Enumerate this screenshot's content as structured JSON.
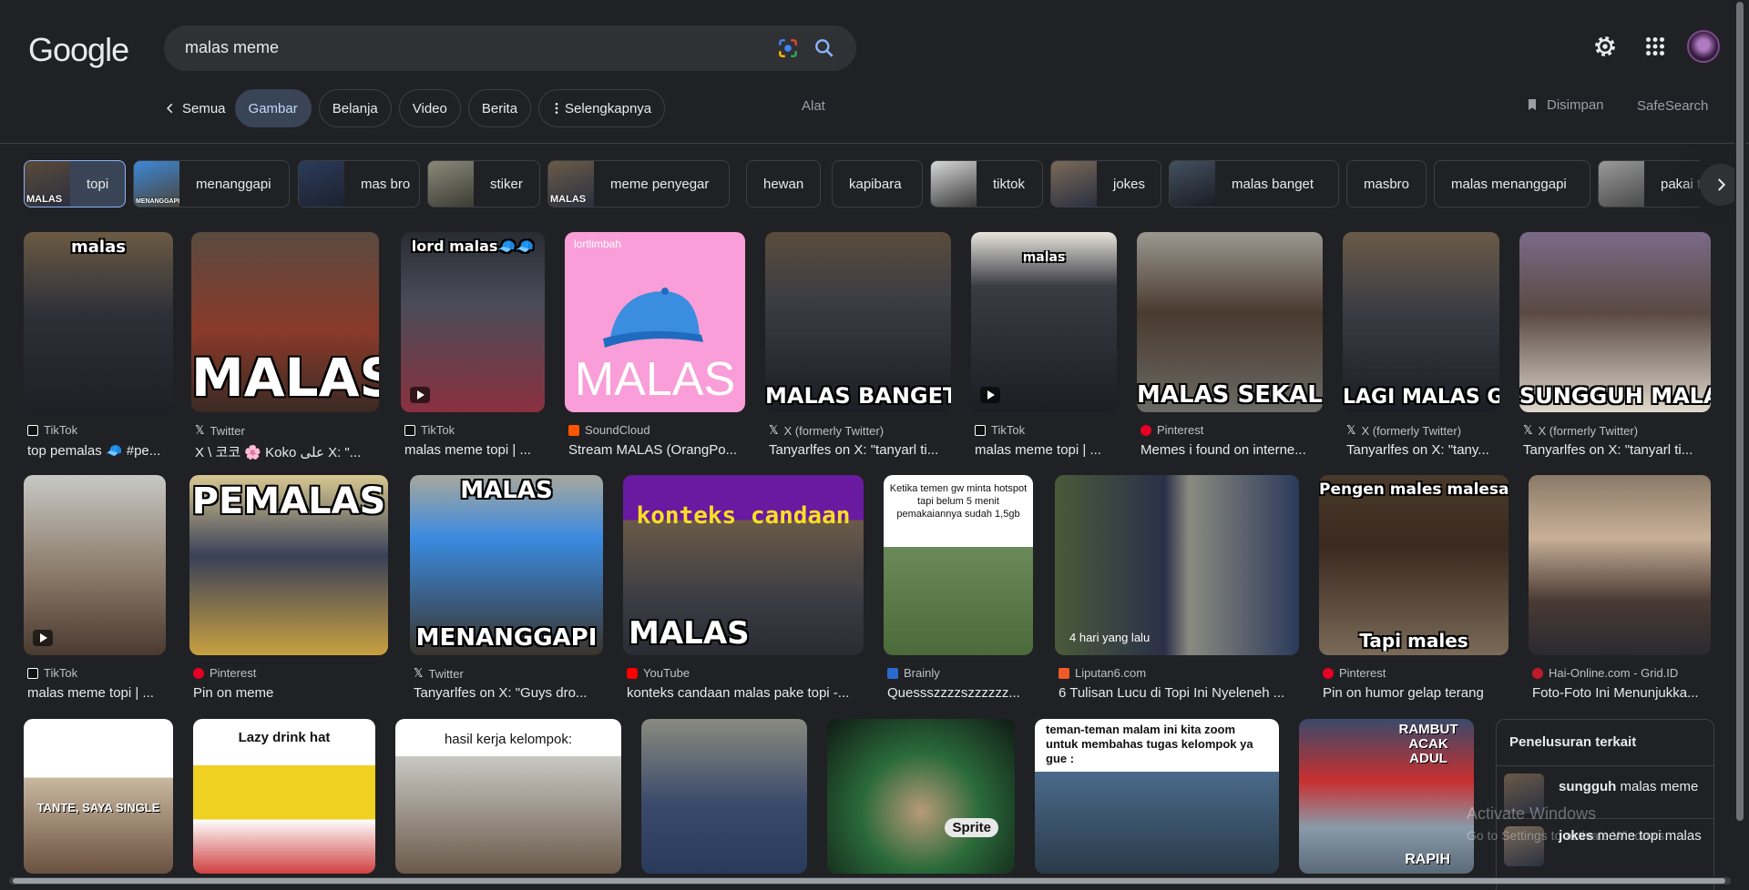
{
  "header": {
    "logo": "Google",
    "search_query": "malas meme",
    "icons": [
      "lens-icon",
      "search-icon",
      "gear-icon",
      "apps-grid-icon",
      "avatar"
    ]
  },
  "tabs": {
    "back_label": "Semua",
    "items": [
      "Gambar",
      "Belanja",
      "Video",
      "Berita",
      "Selengkapnya"
    ],
    "active": "Gambar",
    "tools": "Alat",
    "saved": "Disimpan",
    "safesearch": "SafeSearch"
  },
  "chips": [
    "topi",
    "menanggapi",
    "mas bro",
    "stiker",
    "meme penyegar",
    "hewan",
    "kapibara",
    "tiktok",
    "jokes",
    "malas banget",
    "masbro",
    "malas menanggapi",
    "pakai t"
  ],
  "chip_thumb_text": [
    "MALAS",
    "MENANGGAPI",
    "",
    "",
    "MALAS",
    "",
    "",
    "",
    "",
    "",
    "",
    "",
    ""
  ],
  "results_row1": [
    {
      "source": "TikTok",
      "title": "top pemalas 🧢 #pe...",
      "caption_top": "malas",
      "caption_bottom": ""
    },
    {
      "source": "Twitter",
      "title": "X \\ 코코 🌸 Koko على X: \"...",
      "caption_top": "",
      "caption_bottom": "MALAS"
    },
    {
      "source": "TikTok",
      "title": "malas meme topi | ...",
      "caption_top": "lord malas🧢🧢",
      "caption_bottom": ""
    },
    {
      "source": "SoundCloud",
      "title": "Stream MALAS (OrangPo...",
      "caption_top": "lortlimbah",
      "caption_bottom": "MALAS"
    },
    {
      "source": "X (formerly Twitter)",
      "title": "Tanyarlfes on X: \"tanyarl ti...",
      "caption_top": "",
      "caption_bottom": "MALAS BANGET"
    },
    {
      "source": "TikTok",
      "title": "malas meme topi | ...",
      "caption_top": "malas",
      "caption_bottom": ""
    },
    {
      "source": "Pinterest",
      "title": "Memes i found on interne...",
      "caption_top": "",
      "caption_bottom": "MALAS SEKALI"
    },
    {
      "source": "X (formerly Twitter)",
      "title": "Tanyarlfes on X: \"tany...",
      "caption_top": "",
      "caption_bottom": "LAGI MALAS GW"
    },
    {
      "source": "X (formerly Twitter)",
      "title": "Tanyarlfes on X: \"tanyarl ti...",
      "caption_top": "",
      "caption_bottom": "SUNGGUH MALAS"
    }
  ],
  "results_row2": [
    {
      "source": "TikTok",
      "title": "malas meme topi | ...",
      "caption_top": "",
      "caption_bottom": ""
    },
    {
      "source": "Pinterest",
      "title": "Pin on meme",
      "caption_top": "PEMALAS",
      "caption_bottom": ""
    },
    {
      "source": "Twitter",
      "title": "Tanyarlfes on X: \"Guys dro...",
      "caption_top": "MALAS",
      "caption_bottom": "MENANGGAPI"
    },
    {
      "source": "YouTube",
      "title": "konteks candaan malas pake topi -...",
      "caption_top": "konteks candaan",
      "caption_bottom": "MALAS"
    },
    {
      "source": "Brainly",
      "title": "Quessszzzzszzzzzz...",
      "caption_top": "Ketika temen gw minta hotspot tapi belum 5 menit pemakaiannya sudah 1,5gb",
      "caption_bottom": ""
    },
    {
      "source": "Liputan6.com",
      "title": "6 Tulisan Lucu di Topi Ini Nyeleneh ...",
      "caption_top": "",
      "caption_bottom": "4 hari yang lalu"
    },
    {
      "source": "Pinterest",
      "title": "Pin on humor gelap terang",
      "caption_top": "Pengen males malesan",
      "caption_bottom": "Tapi males"
    },
    {
      "source": "Hai-Online.com - Grid.ID",
      "title": "Foto-Foto Ini Menunjukka...",
      "caption_top": "",
      "caption_bottom": ""
    }
  ],
  "results_row3": [
    {
      "caption_top": "",
      "caption_bottom": "TANTE, SAYA SINGLE"
    },
    {
      "caption_top": "Lazy drink hat",
      "caption_bottom": ""
    },
    {
      "caption_top": "hasil kerja kelompok:",
      "caption_bottom": ""
    },
    {
      "caption_top": "",
      "caption_bottom": ""
    },
    {
      "caption_top": "",
      "caption_bottom": "Sprite"
    },
    {
      "caption_top": "teman-teman malam ini kita zoom untuk membahas tugas kelompok ya gue :",
      "caption_bottom": ""
    },
    {
      "caption_top": "RAMBUT ACAK ADUL",
      "caption_bottom": "RAPIH"
    }
  ],
  "related": {
    "title": "Penelusuran terkait",
    "items": [
      {
        "bold": "sungguh",
        "rest": " malas meme"
      },
      {
        "bold": "jokes",
        "rest": " meme topi malas"
      }
    ]
  },
  "watermark": {
    "line1": "Activate Windows",
    "line2": "Go to Settings to activate Windows."
  },
  "colors": {
    "background": "#202124",
    "surface": "#303134",
    "active_tab": "#394457",
    "accent": "#8ab4f8",
    "text": "#e8eaed",
    "muted": "#9aa0a6"
  }
}
